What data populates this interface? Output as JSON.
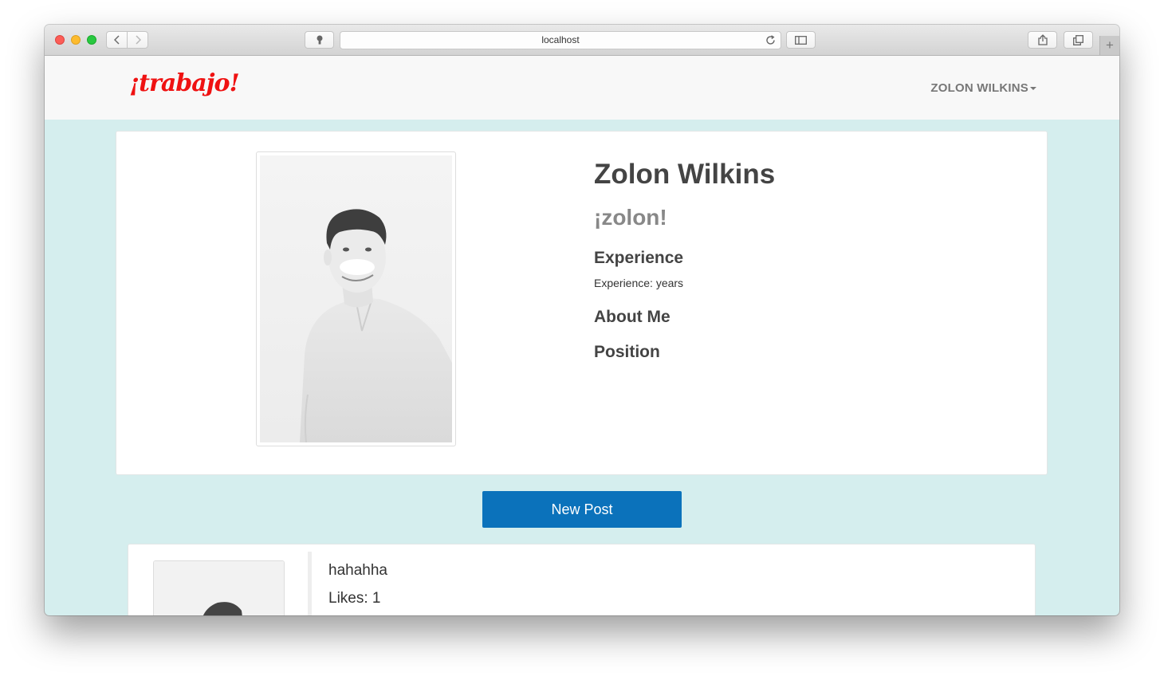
{
  "browser": {
    "url": "localhost",
    "icons": [
      "close-icon",
      "minimize-icon",
      "zoom-icon",
      "back-icon",
      "forward-icon",
      "privacy-icon",
      "reload-icon",
      "sidebar-icon",
      "share-icon",
      "tabs-icon",
      "new-tab-icon"
    ],
    "new_tab_glyph": "+"
  },
  "navbar": {
    "logo": "¡trabajo!",
    "user_menu": "ZOLON WILKINS"
  },
  "profile": {
    "name": "Zolon Wilkins",
    "handle": "¡zolon!",
    "experience_heading": "Experience",
    "experience_text": "Experience: years",
    "about_heading": "About Me",
    "position_heading": "Position"
  },
  "actions": {
    "new_post": "New Post"
  },
  "posts": [
    {
      "text": "hahahha",
      "likes": "Likes: 1"
    }
  ],
  "colors": {
    "page_bg": "#d5eeee",
    "logo": "#ef1212",
    "button": "#0b72bb"
  }
}
